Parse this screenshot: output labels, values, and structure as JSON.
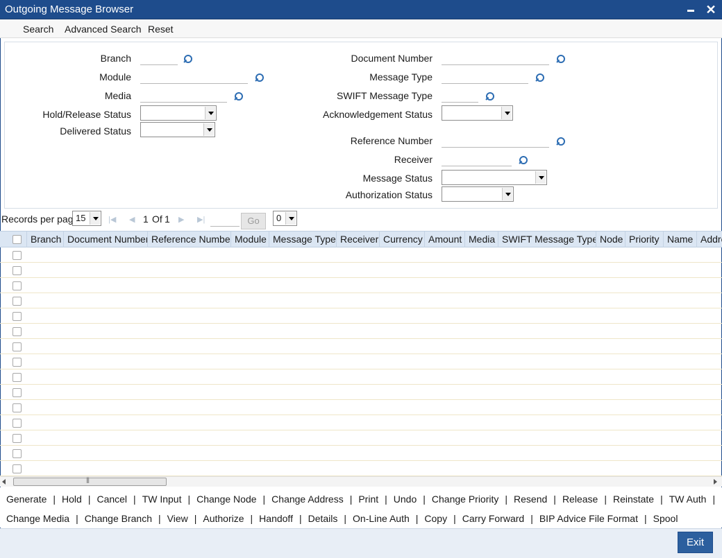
{
  "window": {
    "title": "Outgoing Message Browser"
  },
  "toolbar": {
    "search": "Search",
    "advanced_search": "Advanced Search",
    "reset": "Reset"
  },
  "criteria": {
    "branch": "Branch",
    "module": "Module",
    "media": "Media",
    "hold_release_status": "Hold/Release Status",
    "delivered_status": "Delivered Status",
    "document_number": "Document Number",
    "message_type": "Message Type",
    "swift_message_type": "SWIFT Message Type",
    "acknowledgement_status": "Acknowledgement Status",
    "reference_number": "Reference Number",
    "receiver": "Receiver",
    "message_status": "Message Status",
    "authorization_status": "Authorization Status"
  },
  "pager": {
    "records_per_page_label": "Records per page",
    "records_per_page": "15",
    "page": "1",
    "of": "Of",
    "total": "1",
    "go": "Go",
    "jump": "0"
  },
  "grid": {
    "columns": [
      "Branch",
      "Document Number",
      "Reference Number",
      "Module",
      "Message Type",
      "Receiver",
      "Currency",
      "Amount",
      "Media",
      "SWIFT Message Type",
      "Node",
      "Priority",
      "Name",
      "Address"
    ]
  },
  "actions": {
    "row1": [
      "Generate",
      "Hold",
      "Cancel",
      "TW Input",
      "Change Node",
      "Change Address",
      "Print",
      "Undo",
      "Change Priority",
      "Resend",
      "Release",
      "Reinstate",
      "TW Auth"
    ],
    "row2": [
      "Change Media",
      "Change Branch",
      "View",
      "Authorize",
      "Handoff",
      "Details",
      "On-Line Auth",
      "Copy",
      "Carry Forward",
      "BIP Advice File Format",
      "Spool"
    ]
  },
  "footer": {
    "exit": "Exit"
  },
  "colors": {
    "titlebar": "#1e4c8c",
    "grid_header": "#dbe6f3",
    "exit_button": "#2c5f9e"
  },
  "icons": [
    "search-lens-icon",
    "minimize-icon",
    "close-icon",
    "first-page-icon",
    "previous-page-icon",
    "next-page-icon",
    "last-page-icon",
    "dropdown-arrow-icon"
  ]
}
